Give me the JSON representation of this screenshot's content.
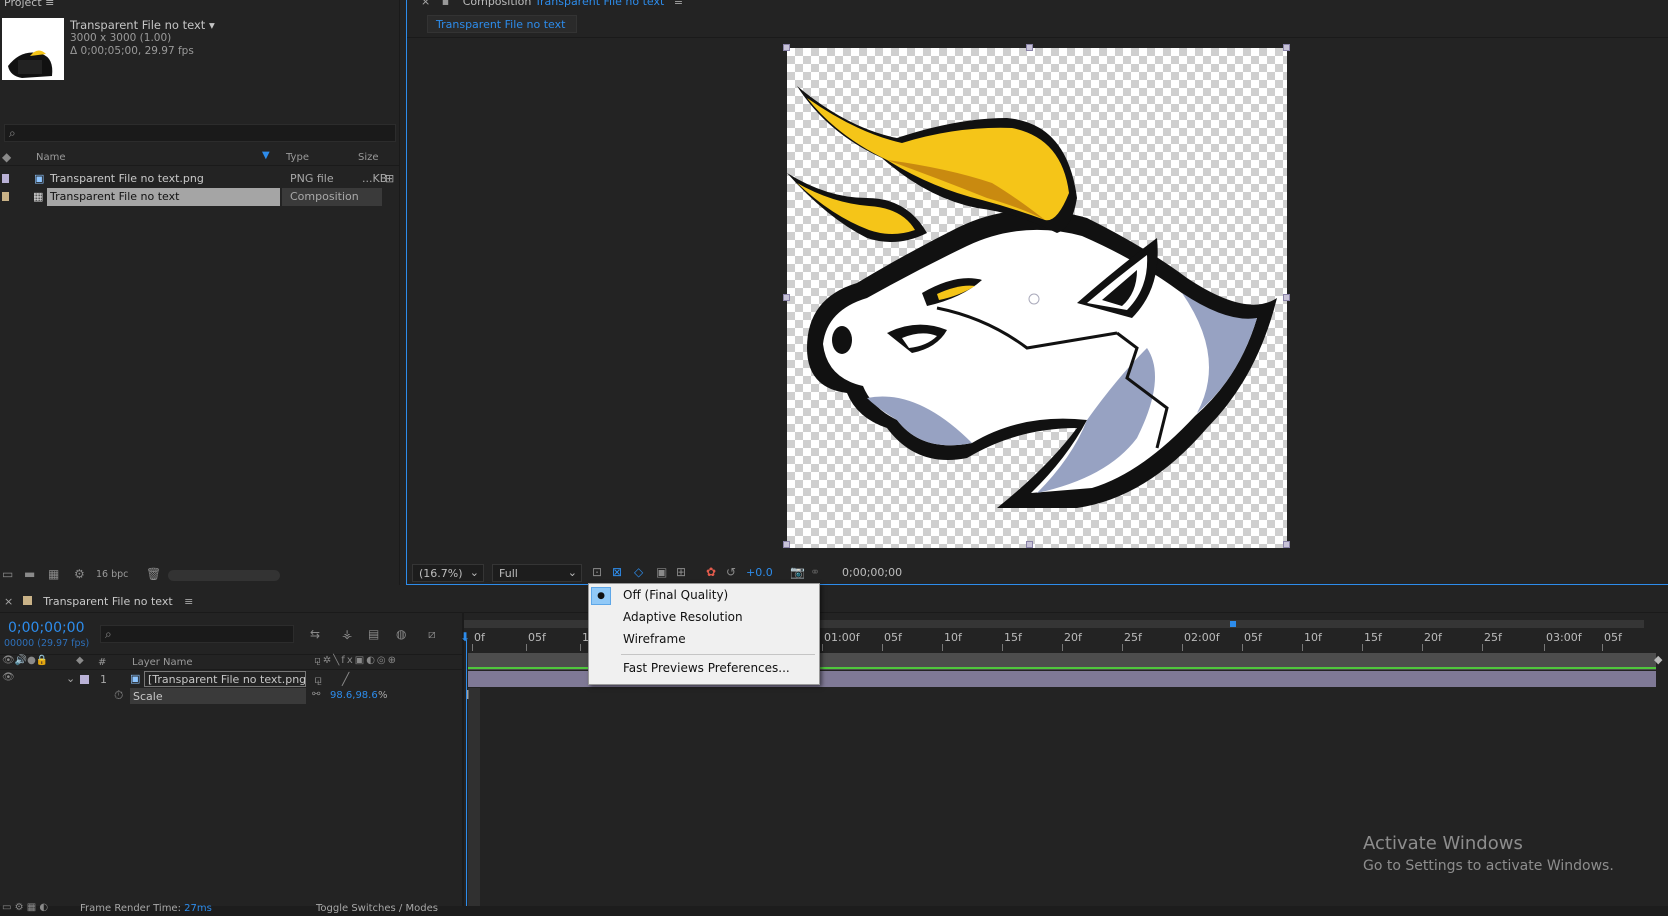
{
  "project": {
    "title": "Project",
    "item_name": "Transparent File no text",
    "dimensions": "3000 x 3000 (1.00)",
    "duration": "Δ 0;00;05;00, 29.97 fps",
    "columns": {
      "name": "Name",
      "type": "Type",
      "size": "Size"
    },
    "items": [
      {
        "name": "Transparent File no text.png",
        "type": "PNG file",
        "size": "...KB"
      },
      {
        "name": "Transparent File no text",
        "type": "Composition",
        "size": ""
      }
    ],
    "bpc": "16 bpc"
  },
  "composition": {
    "panel_label": "Composition",
    "panel_name": "Transparent File no text",
    "tab": "Transparent File no text",
    "zoom": "(16.7%)",
    "resolution": "Full",
    "exposure": "+0.0",
    "timecode": "0;00;00;00"
  },
  "fast_previews_menu": {
    "items": [
      {
        "label": "Off (Final Quality)",
        "selected": true
      },
      {
        "label": "Adaptive Resolution",
        "selected": false
      },
      {
        "label": "Wireframe",
        "selected": false
      },
      {
        "label": "Fast Previews Preferences...",
        "selected": false
      }
    ]
  },
  "timeline": {
    "tab": "Transparent File no text",
    "timecode": "0;00;00;00",
    "frames": "00000 (29.97 fps)",
    "col_layer_name": "Layer Name",
    "col_num": "#",
    "layer_index": "1",
    "layer_name": "[Transparent File no text.png]",
    "property": "Scale",
    "scale_value": "98.6,98.6",
    "scale_unit": "%",
    "ruler": [
      "0f",
      "05f",
      "1",
      "01:00f",
      "05f",
      "10f",
      "15f",
      "20f",
      "25f",
      "02:00f",
      "05f",
      "10f",
      "15f",
      "20f",
      "25f",
      "03:00f",
      "05f"
    ]
  },
  "status": {
    "render_label": "Frame Render Time:",
    "render_value": "27ms",
    "toggle": "Toggle Switches / Modes"
  },
  "watermark": {
    "title": "Activate Windows",
    "subtitle": "Go to Settings to activate Windows."
  },
  "colors": {
    "accent": "#2d8ceb",
    "layer_bar": "#7f7996",
    "label_purple": "#b9b1d6"
  }
}
